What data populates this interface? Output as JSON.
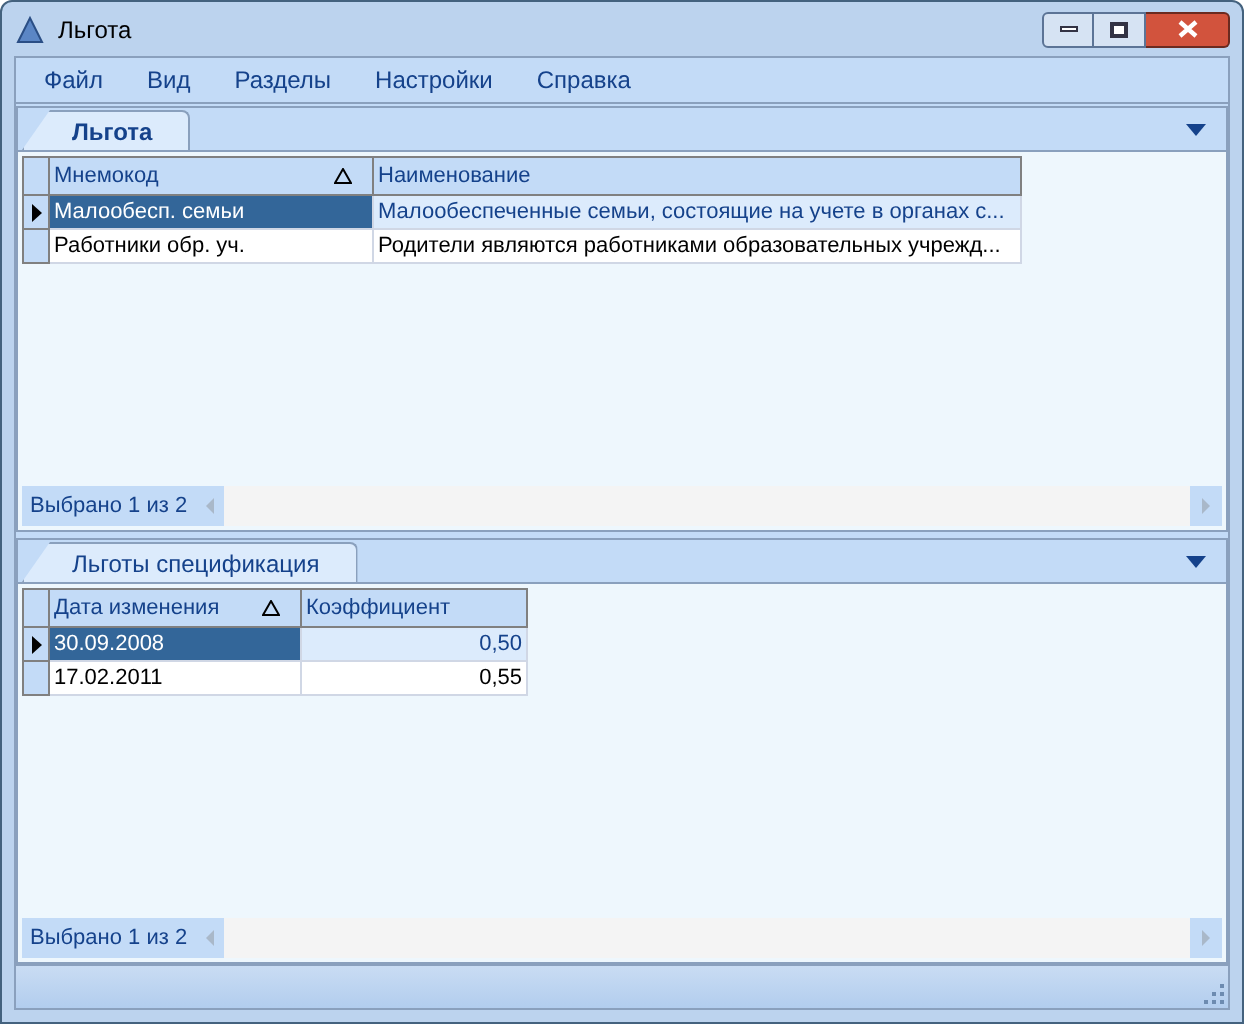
{
  "window": {
    "title": "Льгота"
  },
  "menu": [
    "Файл",
    "Вид",
    "Разделы",
    "Настройки",
    "Справка"
  ],
  "panes": [
    {
      "tab": {
        "label": "Льгота",
        "selected": true
      },
      "columns": [
        {
          "label": "Мнемокод",
          "sorted": true,
          "kind": "text"
        },
        {
          "label": "Наименование",
          "sorted": false,
          "kind": "text"
        }
      ],
      "rows": [
        {
          "selected": true,
          "cells": [
            "Малообесп. семьи",
            "Малообеспеченные семьи, состоящие на учете в органах с..."
          ]
        },
        {
          "selected": false,
          "cells": [
            "Работники обр. уч.",
            "Родители являются работниками образовательных учрежд..."
          ]
        }
      ],
      "footer": "Выбрано 1 из 2"
    },
    {
      "tab": {
        "label": "Льготы спецификация",
        "selected": false
      },
      "columns": [
        {
          "label": "Дата изменения",
          "sorted": true,
          "kind": "text"
        },
        {
          "label": "Коэффициент",
          "sorted": false,
          "kind": "number"
        }
      ],
      "rows": [
        {
          "selected": true,
          "cells": [
            "30.09.2008",
            "0,50"
          ]
        },
        {
          "selected": false,
          "cells": [
            "17.02.2011",
            "0,55"
          ]
        }
      ],
      "footer": "Выбрано 1 из 2"
    }
  ]
}
